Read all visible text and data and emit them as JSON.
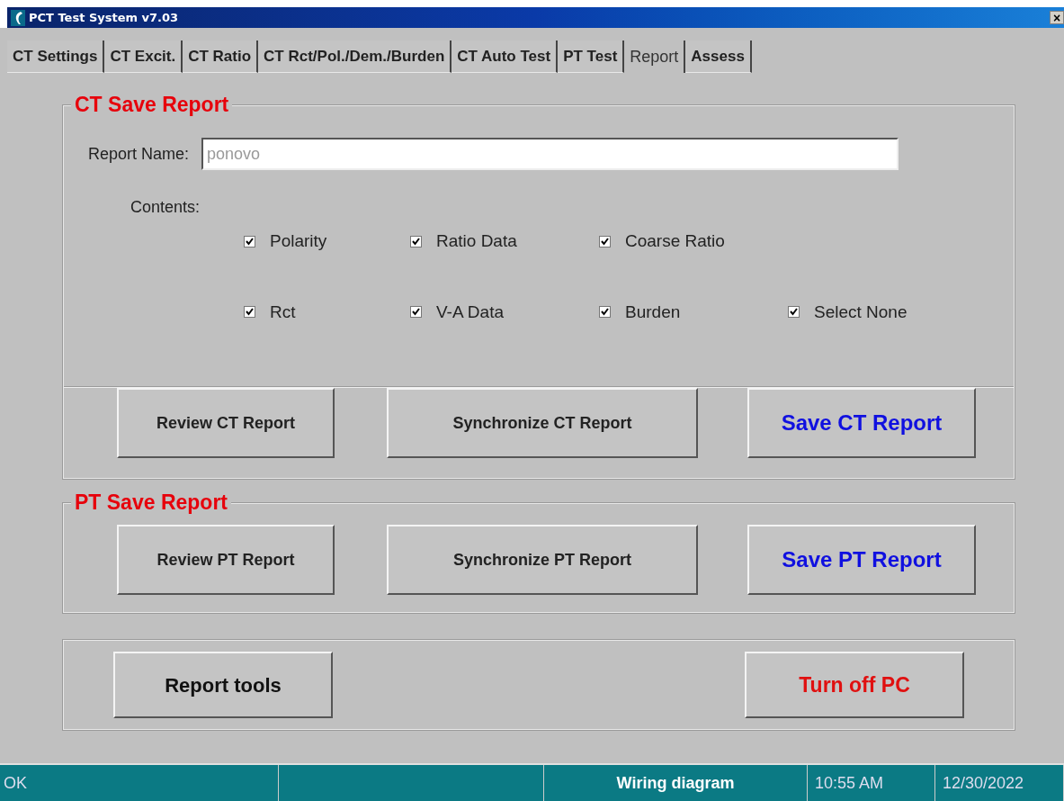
{
  "window": {
    "title": "PCT Test System v7.03",
    "close": "×"
  },
  "tabs": [
    {
      "label": "CT Settings",
      "selected": false
    },
    {
      "label": "CT Excit.",
      "selected": false
    },
    {
      "label": "CT Ratio",
      "selected": false
    },
    {
      "label": "CT Rct/Pol./Dem./Burden",
      "selected": false
    },
    {
      "label": "CT Auto Test",
      "selected": false
    },
    {
      "label": "PT Test",
      "selected": false
    },
    {
      "label": "Report",
      "selected": true
    },
    {
      "label": "Assess",
      "selected": false
    }
  ],
  "ct_group": {
    "title": "CT Save Report",
    "report_name_label": "Report Name:",
    "report_name_value": "ponovo",
    "contents_label": "Contents:",
    "checkbox_rows": [
      [
        {
          "label": "Polarity",
          "checked": true
        },
        {
          "label": "Ratio Data",
          "checked": true
        },
        {
          "label": "Coarse Ratio",
          "checked": true
        }
      ],
      [
        {
          "label": "Rct",
          "checked": true
        },
        {
          "label": "V-A Data",
          "checked": true
        },
        {
          "label": "Burden",
          "checked": true
        },
        {
          "label": "Select None",
          "checked": true
        }
      ]
    ],
    "buttons": [
      {
        "label": "Review CT Report",
        "kind": "normal"
      },
      {
        "label": "Synchronize CT Report",
        "kind": "normal"
      },
      {
        "label": "Save CT Report",
        "kind": "primary"
      }
    ]
  },
  "pt_group": {
    "title": "PT Save Report",
    "buttons": [
      {
        "label": "Review PT Report",
        "kind": "normal"
      },
      {
        "label": "Synchronize PT Report",
        "kind": "normal"
      },
      {
        "label": "Save PT Report",
        "kind": "primary"
      }
    ]
  },
  "bottom_buttons": [
    {
      "label": "Report tools",
      "kind": "large"
    },
    {
      "label": "Turn off PC",
      "kind": "danger"
    }
  ],
  "status_bar": {
    "message": "OK",
    "link": "Wiring diagram",
    "time": "10:55 AM",
    "date": "12/30/2022"
  }
}
